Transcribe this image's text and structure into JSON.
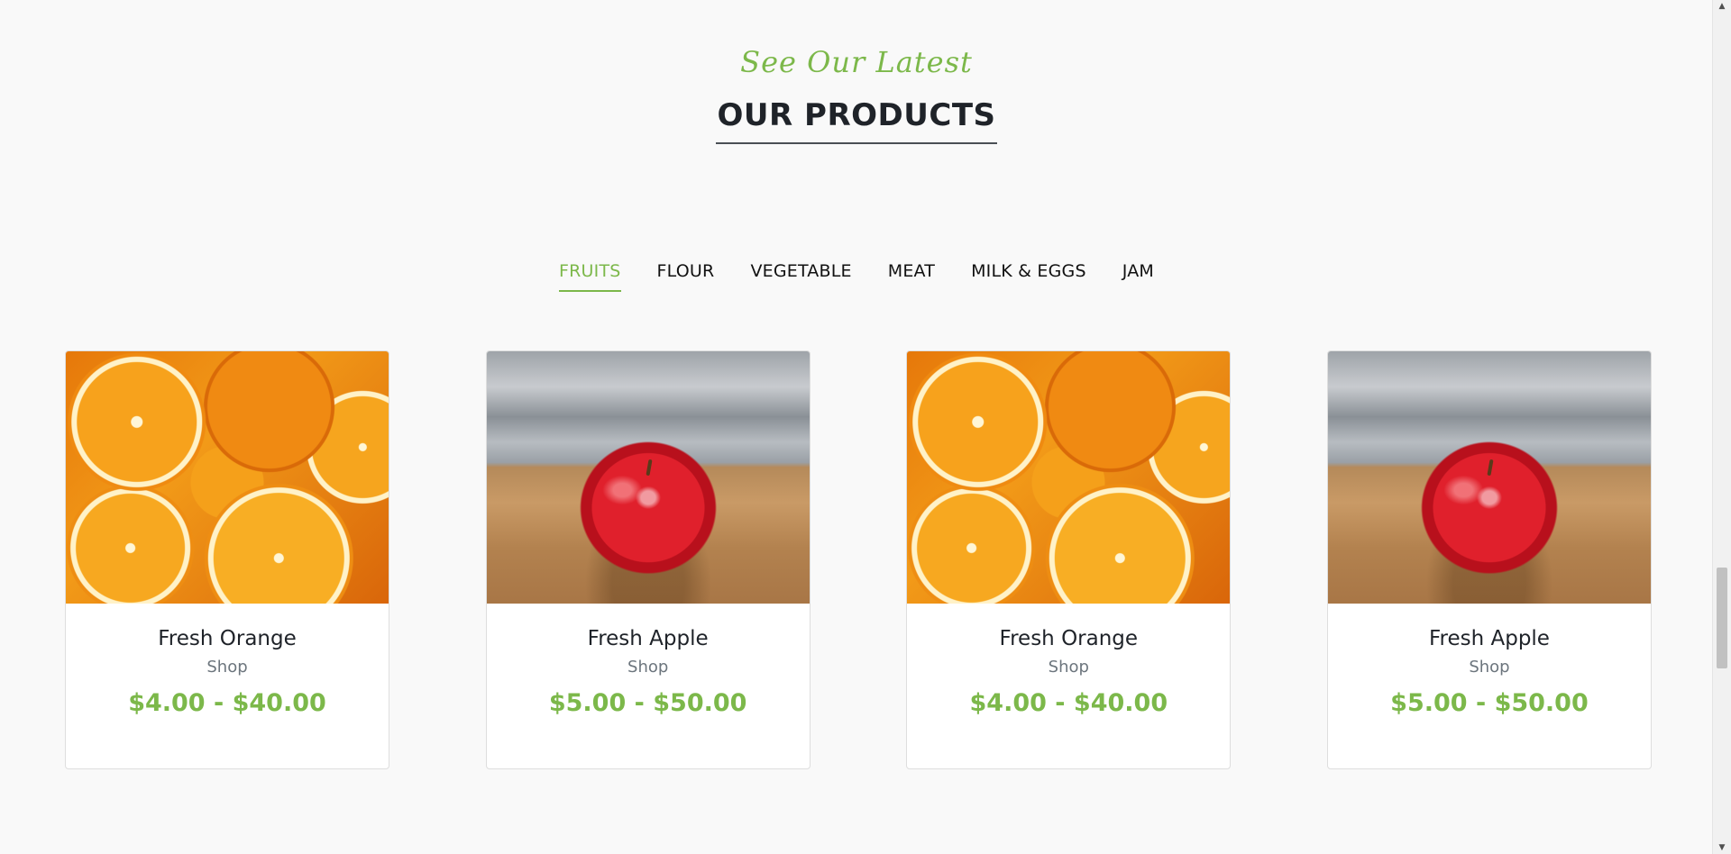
{
  "section": {
    "subtitle": "See Our Latest",
    "title": "OUR PRODUCTS"
  },
  "tabs": [
    {
      "label": "FRUITS",
      "active": true
    },
    {
      "label": "FLOUR",
      "active": false
    },
    {
      "label": "VEGETABLE",
      "active": false
    },
    {
      "label": "MEAT",
      "active": false
    },
    {
      "label": "MILK & EGGS",
      "active": false
    },
    {
      "label": "JAM",
      "active": false
    }
  ],
  "products": [
    {
      "name": "Fresh Orange",
      "category": "Shop",
      "price": "$4.00 - $40.00",
      "image": "orange"
    },
    {
      "name": "Fresh Apple",
      "category": "Shop",
      "price": "$5.00 - $50.00",
      "image": "apple"
    },
    {
      "name": "Fresh Orange",
      "category": "Shop",
      "price": "$4.00 - $40.00",
      "image": "orange"
    },
    {
      "name": "Fresh Apple",
      "category": "Shop",
      "price": "$5.00 - $50.00",
      "image": "apple"
    }
  ],
  "colors": {
    "accent": "#7cb84a",
    "heading": "#1f2329",
    "muted": "#6c757d",
    "background": "#f9f9f9"
  },
  "icons": {
    "scroll_up": "triangle-up-icon",
    "scroll_down": "triangle-down-icon"
  }
}
